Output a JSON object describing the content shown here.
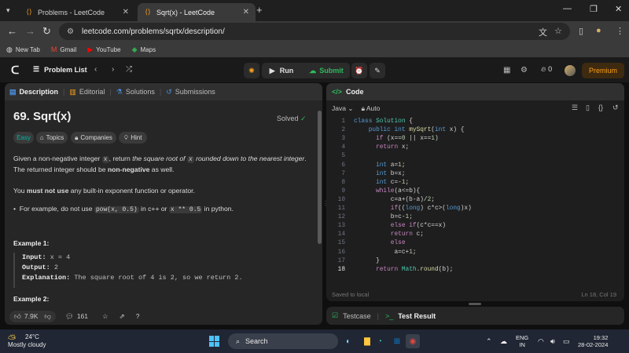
{
  "browser": {
    "tabs": [
      {
        "title": "Problems - LeetCode"
      },
      {
        "title": "Sqrt(x) - LeetCode"
      }
    ],
    "url": "leetcode.com/problems/sqrtx/description/",
    "bookmarks": [
      "New Tab",
      "Gmail",
      "YouTube",
      "Maps"
    ]
  },
  "leetcode": {
    "problem_list_label": "Problem List",
    "run_label": "Run",
    "submit_label": "Submit",
    "streak_count": "0",
    "premium_label": "Premium"
  },
  "left_panel": {
    "tabs": [
      "Description",
      "Editorial",
      "Solutions",
      "Submissions"
    ],
    "title": "69. Sqrt(x)",
    "status": "Solved",
    "chips": [
      "Easy",
      "Topics",
      "Companies",
      "Hint"
    ],
    "desc": {
      "p1_a": "Given a non-negative integer ",
      "p1_code": "x",
      "p1_b": ", return ",
      "p1_em1": "the square root of ",
      "p1_code2": "x",
      "p1_em2": " rounded down to the nearest integer",
      "p1_c": ".",
      "p2_a": "The returned integer should be ",
      "p2_b": "non-negative",
      "p2_c": " as well.",
      "p3_a": "You ",
      "p3_b": "must not use",
      "p3_c": " any built-in exponent function or operator.",
      "bullet_a": "For example, do not use ",
      "bullet_code1": "pow(x, 0.5)",
      "bullet_b": " in c++ or ",
      "bullet_code2": "x ** 0.5",
      "bullet_c": " in python."
    },
    "example1_title": "Example 1:",
    "example1": {
      "input_label": "Input:",
      "input": "x = 4",
      "output_label": "Output:",
      "output": "2",
      "expl_label": "Explanation:",
      "explanation": "The square root of 4 is 2, so we return 2."
    },
    "example2_title": "Example 2:",
    "footer": {
      "likes": "7.9K",
      "comments": "161"
    }
  },
  "right_panel": {
    "title": "Code",
    "language": "Java",
    "mode": "Auto",
    "code_lines": [
      "class Solution {",
      "    public int mySqrt(int x) {",
      "      if (x==0 || x==1)",
      "      return x;",
      "",
      "      int a=1;",
      "      int b=x;",
      "      int c=-1;",
      "      while(a<=b){",
      "          c=a+(b-a)/2;",
      "          if((long) c*c>(long)x)",
      "          b=c-1;",
      "          else if(c*c==x)",
      "          return c;",
      "          else",
      "           a=c+1;",
      "      }",
      "      return Math.round(b);"
    ],
    "line_numbers": [
      "1",
      "2",
      "3",
      "4",
      "5",
      "6",
      "7",
      "8",
      "9",
      "10",
      "11",
      "12",
      "13",
      "14",
      "15",
      "16",
      "17",
      "18"
    ],
    "saved_status": "Saved to local",
    "cursor_pos": "Ln 18, Col 19",
    "testcase_label": "Testcase",
    "test_result_label": "Test Result"
  },
  "taskbar": {
    "temp": "24°C",
    "weather": "Mostly cloudy",
    "search": "Search",
    "lang1": "ENG",
    "lang2": "IN",
    "time": "19:32",
    "date": "28-02-2024"
  },
  "colors": {
    "accent_green": "#2cbb5d",
    "accent_orange": "#ffa116",
    "easy_teal": "#00b8a3"
  }
}
